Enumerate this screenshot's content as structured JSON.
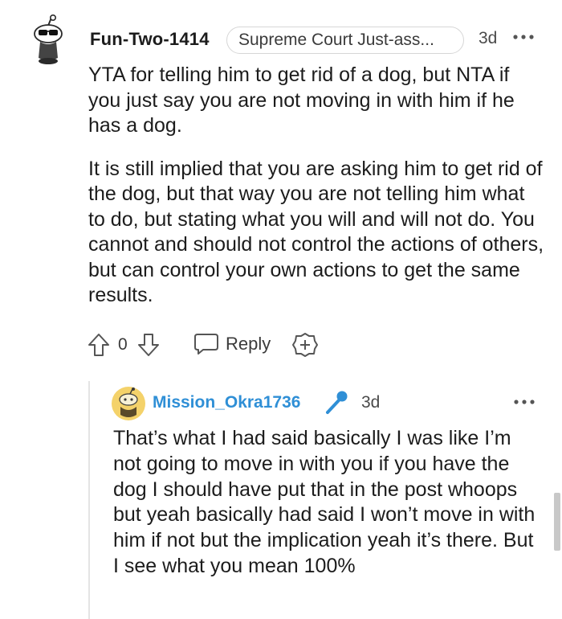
{
  "comment": {
    "username": "Fun-Two-1414",
    "flair": "Supreme Court Just-ass...",
    "time": "3d",
    "paragraphs": [
      "YTA for telling him to get rid of a dog, but NTA if you just say you are not moving in with him if he has a dog.",
      "It is still implied that you are asking him to get rid of the dog, but that way you are not telling him what to do, but stating what you will and will not do. You cannot and should not control the actions of others, but can control your own actions to get the same results."
    ],
    "score": "0",
    "reply_label": "Reply",
    "icons": {
      "avatar": "snoo-sunglasses-avatar-icon",
      "more": "more-dots-icon",
      "upvote": "upvote-arrow-icon",
      "downvote": "downvote-arrow-icon",
      "reply": "speech-bubble-icon",
      "award": "award-plus-icon"
    }
  },
  "reply": {
    "username": "Mission_Okra1736",
    "time": "3d",
    "body": "That’s what I had said basically I was like I’m not going to move in with you if you have the dog I should have put that in the post whoops but yeah basically had said I won’t move in with him if not but the implication yeah it’s there. But I see what you mean 100%",
    "icons": {
      "avatar": "snoo-yellow-avatar-icon",
      "mic": "microphone-icon",
      "more": "more-dots-icon"
    }
  },
  "colors": {
    "username_reply": "#2f8fd6",
    "text": "#1c1c1c",
    "muted": "#4a4a4a"
  }
}
